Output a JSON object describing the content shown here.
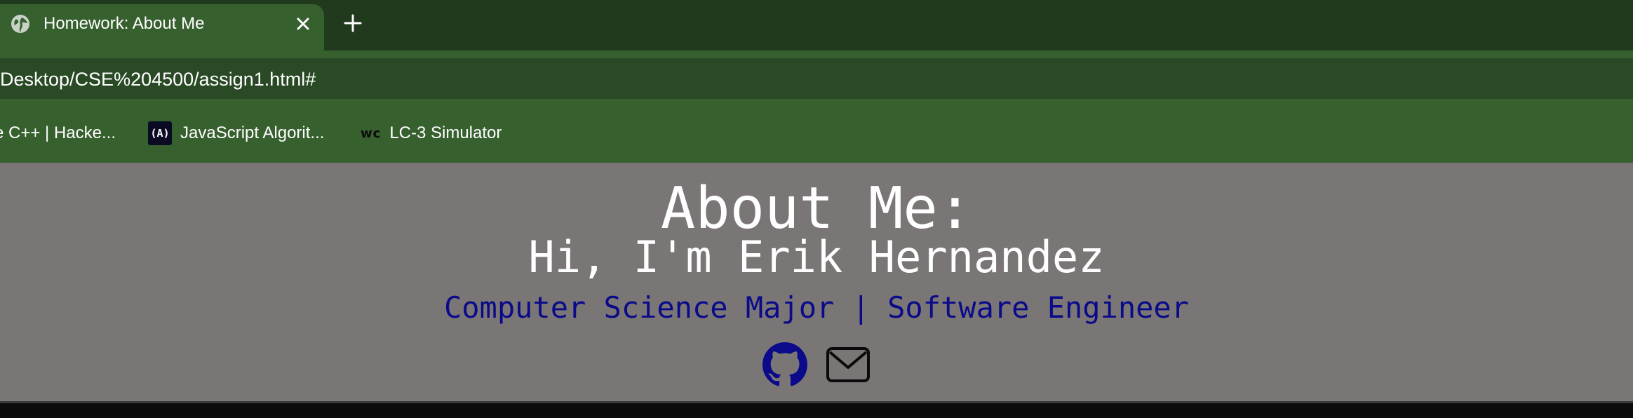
{
  "browser": {
    "tab": {
      "title": "Homework: About Me",
      "favicon": "globe-icon",
      "close_icon": "close-icon"
    },
    "new_tab_icon": "plus-icon",
    "omnibox": {
      "url": "Desktop/CSE%204500/assign1.html#"
    },
    "bookmarks": [
      {
        "label": "e C++ | Hacke...",
        "icon": ""
      },
      {
        "label": "JavaScript Algorit...",
        "icon": "freecodecamp-icon",
        "icon_text": "(A)"
      },
      {
        "label": "LC-3 Simulator",
        "icon": "wc-icon",
        "icon_text": "wc"
      }
    ],
    "colors": {
      "tabstrip": "#213a1e",
      "toolbar": "#37602f",
      "page_background": "#7a7676",
      "tagline": "#0a0a8a"
    }
  },
  "page": {
    "title": "About Me:",
    "subtitle": "Hi, I'm Erik Hernandez",
    "tagline": "Computer Science Major | Software Engineer",
    "socials": [
      {
        "name": "github-icon",
        "color": "#0a0a8a"
      },
      {
        "name": "mail-icon",
        "color": "#0a0a0a"
      }
    ]
  }
}
